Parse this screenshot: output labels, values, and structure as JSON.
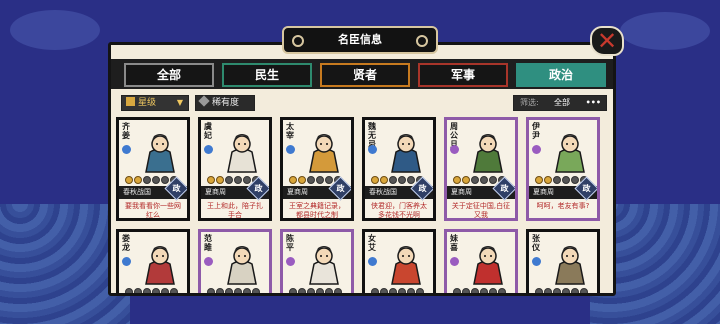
{
  "window": {
    "title": "名臣信息",
    "close_glyph": "✕"
  },
  "tabs": [
    {
      "label": "全部",
      "active": true,
      "color": "#8a8a8a"
    },
    {
      "label": "民生",
      "active": false,
      "color": "#2e8a6e"
    },
    {
      "label": "贤者",
      "active": false,
      "color": "#c77a1f"
    },
    {
      "label": "军事",
      "active": false,
      "color": "#a8352a"
    },
    {
      "label": "政治",
      "active": false,
      "color": "#2f8f80"
    }
  ],
  "filters": {
    "rank_label": "星级",
    "rarity_label": "稀有度",
    "filter_label": "筛选:",
    "filter_value": "全部",
    "more": "•••"
  },
  "ministers": [
    {
      "name": "齐姜",
      "era": "春秋战国",
      "quote": "要我看看你一些网红么",
      "badge": "政",
      "stars": 2,
      "rarity": "normal",
      "robe": "#3a6f8f"
    },
    {
      "name": "虞妃",
      "era": "夏商周",
      "quote": "王上和此，陪子扎手合",
      "badge": "政",
      "stars": 2,
      "rarity": "normal",
      "robe": "#e7e2d6"
    },
    {
      "name": "太宰",
      "era": "夏商周",
      "quote": "王室之典籍记录，都县时代之制",
      "badge": "政",
      "stars": 2,
      "rarity": "normal",
      "robe": "#d49a3a"
    },
    {
      "name": "魏无忌",
      "era": "春秋战国",
      "quote": "侠君迎，门客养太多花钱不光啊",
      "badge": "政",
      "stars": 2,
      "rarity": "normal",
      "robe": "#2f5a86"
    },
    {
      "name": "周公旦",
      "era": "夏商周",
      "quote": "关于定征中国,白征又我",
      "badge": "政",
      "stars": 2,
      "rarity": "purple",
      "robe": "#4f7a3a"
    },
    {
      "name": "伊尹",
      "era": "夏商周",
      "quote": "呵呵，老友有事?",
      "badge": "政",
      "stars": 2,
      "rarity": "purple",
      "robe": "#79a85a"
    },
    {
      "name": "娄龙",
      "era": "",
      "quote": "",
      "badge": "",
      "stars": 0,
      "rarity": "normal",
      "robe": "#b23a3a"
    },
    {
      "name": "范雎",
      "era": "",
      "quote": "",
      "badge": "",
      "stars": 0,
      "rarity": "purple",
      "robe": "#d8d2c2"
    },
    {
      "name": "陈平",
      "era": "",
      "quote": "",
      "badge": "",
      "stars": 0,
      "rarity": "purple",
      "robe": "#e9e4da"
    },
    {
      "name": "女艾",
      "era": "",
      "quote": "",
      "badge": "",
      "stars": 0,
      "rarity": "normal",
      "robe": "#c9462f"
    },
    {
      "name": "妹喜",
      "era": "",
      "quote": "",
      "badge": "",
      "stars": 0,
      "rarity": "purple",
      "robe": "#c0302e"
    },
    {
      "name": "张仪",
      "era": "",
      "quote": "",
      "badge": "",
      "stars": 0,
      "rarity": "normal",
      "robe": "#8a7a5a"
    }
  ]
}
